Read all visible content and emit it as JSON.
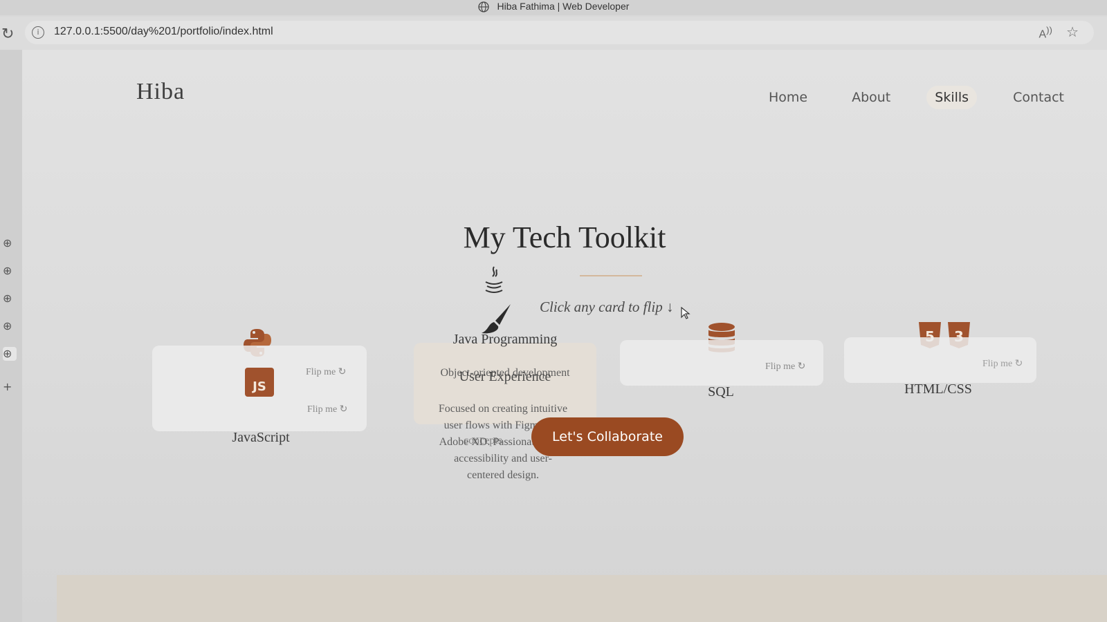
{
  "browser": {
    "tab_title": "Hiba Fathima | Web Developer",
    "url": "127.0.0.1:5500/day%201/portfolio/index.html"
  },
  "nav": {
    "logo": "Hiba",
    "items": [
      {
        "label": "Home"
      },
      {
        "label": "About"
      },
      {
        "label": "Skills"
      },
      {
        "label": "Contact"
      }
    ]
  },
  "section": {
    "title": "My Tech Toolkit",
    "hint": "Click any card to flip ↓"
  },
  "cards": {
    "python": {
      "flip": "Flip me ↻"
    },
    "javascript": {
      "name": "JavaScript",
      "flip": "Flip me ↻"
    },
    "java": {
      "name": "Java Programming",
      "desc": "Object-oriented development"
    },
    "ux": {
      "name": "User Experience",
      "desc_lines": [
        "Focused on creating intuitive",
        "user flows with Figma and",
        "Adobe XD. Passionate about",
        "accessibility and user-",
        "centered design."
      ],
      "overlap": "concepts"
    },
    "sql": {
      "name": "SQL",
      "flip": "Flip me ↻"
    },
    "htmlcss": {
      "name": "HTML/CSS",
      "flip": "Flip me ↻"
    }
  },
  "cta": {
    "label": "Let's Collaborate"
  },
  "colors": {
    "accent": "#9a4a22",
    "icon": "#a0522d"
  },
  "icons": [
    "globe-icon",
    "reload-icon",
    "info-icon",
    "read-aloud-icon",
    "star-icon",
    "python-icon",
    "js-icon",
    "java-icon",
    "paintbrush-icon",
    "database-icon",
    "html5-icon",
    "css3-icon",
    "cursor-icon"
  ]
}
